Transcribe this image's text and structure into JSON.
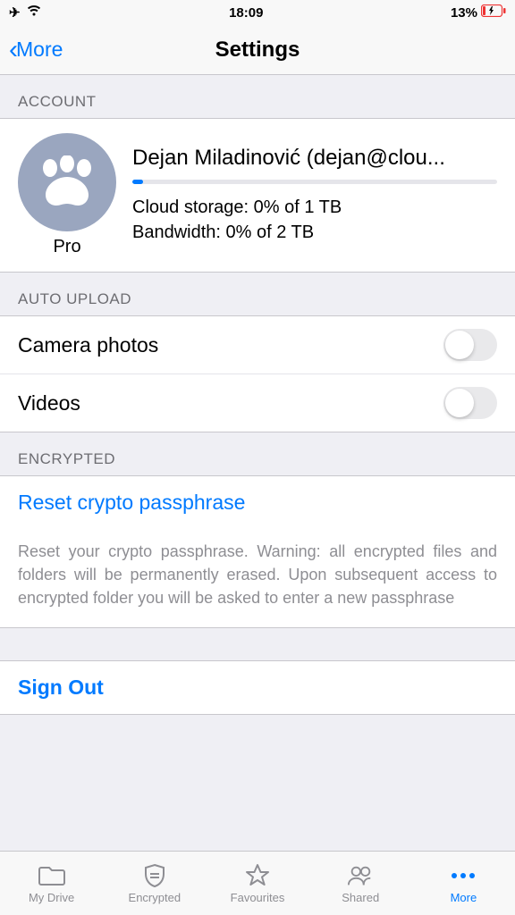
{
  "status": {
    "time": "18:09",
    "battery": "13%"
  },
  "nav": {
    "back": "More",
    "title": "Settings"
  },
  "sections": {
    "account": "ACCOUNT",
    "auto_upload": "AUTO UPLOAD",
    "encrypted": "ENCRYPTED"
  },
  "account": {
    "name": "Dejan Miladinović (dejan@clou...",
    "plan": "Pro",
    "storage": "Cloud storage: 0% of 1 TB",
    "bandwidth": "Bandwidth: 0% of 2 TB"
  },
  "auto_upload": {
    "photos": "Camera photos",
    "videos": "Videos"
  },
  "encrypted": {
    "reset": "Reset crypto passphrase",
    "desc": "Reset your crypto passphrase. Warning: all encrypted files and folders will be permanently erased. Upon subsequent access to encrypted folder you will be asked to enter a new passphrase"
  },
  "signout": "Sign Out",
  "tabs": {
    "drive": "My Drive",
    "encrypted": "Encrypted",
    "favourites": "Favourites",
    "shared": "Shared",
    "more": "More"
  }
}
